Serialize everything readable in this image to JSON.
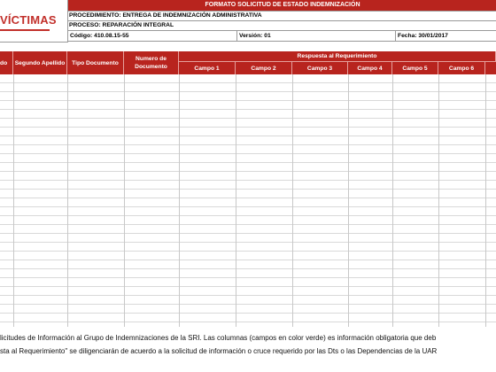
{
  "header": {
    "logo_text": "VÍCTIMAS",
    "form_title": "FORMATO SOLICITUD DE ESTADO INDEMNIZACIÓN",
    "procedimiento": "PROCEDIMIENTO: ENTREGA DE INDEMNIZACIÓN ADMINISTRATIVA",
    "proceso": "PROCESO: REPARACIÓN INTEGRAL",
    "codigo": "Código: 410.08.15-55",
    "version": "Versión: 01",
    "fecha": "Fecha: 30/01/2017"
  },
  "table": {
    "col_partial": "do",
    "col_segundo_apellido": "Segundo Apellido",
    "col_tipo_documento": "Tipo Documento",
    "col_numero_documento": "Numero de Documento",
    "group_respuesta": "Respuesta al Requerimiento",
    "campos": [
      "Campo 1",
      "Campo 2",
      "Campo 3",
      "Campo 4",
      "Campo 5",
      "Campo 6"
    ]
  },
  "note": {
    "line1": "licitudes de Información al Grupo de Indemnizaciones de la SRI. Las columnas (campos en color verde) es información obligatoria que deb",
    "line2": "sta al Requerimiento\" se diligenciarán de acuerdo a la solicitud de información o cruce requerido por las Dts o las Dependencias de la UAR"
  },
  "colors": {
    "header_red": "#b8241e",
    "logo_red": "#c2302b"
  }
}
